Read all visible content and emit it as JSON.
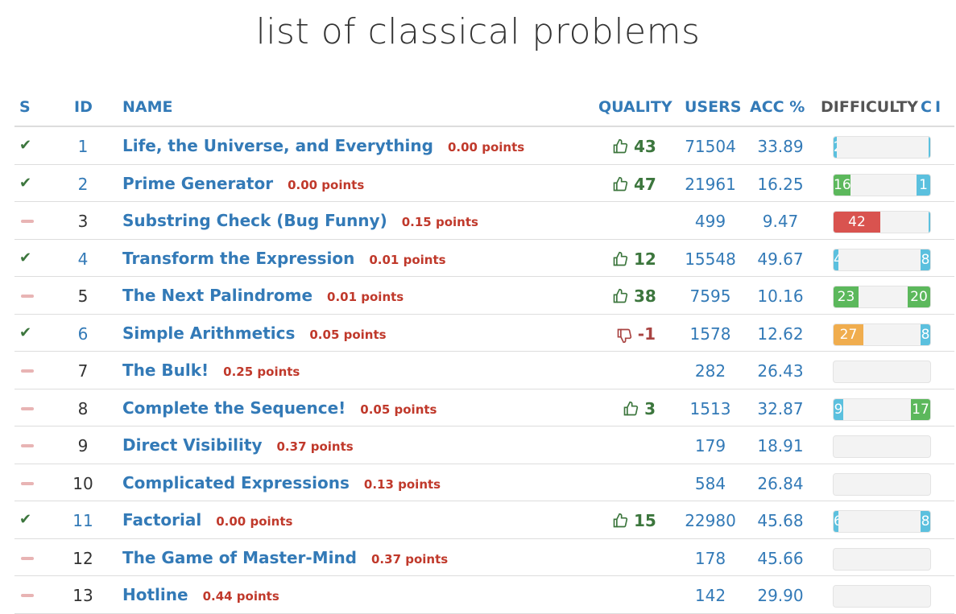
{
  "title": "list of classical problems",
  "columns": {
    "s": "S",
    "id": "ID",
    "name": "NAME",
    "quality": "QUALITY",
    "users": "USERS",
    "acc": "ACC %",
    "difficulty": "DIFFICULTY",
    "c": "C",
    "i": "I"
  },
  "colors": {
    "green": "#5cb85c",
    "blue": "#5bc0de",
    "red": "#d9534f",
    "orange": "#f0ad4e",
    "link": "#337ab7",
    "points": "#c0392b"
  },
  "rows": [
    {
      "status": "solved",
      "id": "1",
      "name": "Life, the Universe, and Everything",
      "points": "0.00 points",
      "quality": "43",
      "qtype": "up",
      "users": "71504",
      "acc": "33.89",
      "dl": {
        "text": "2",
        "color": "blue",
        "w": 3
      },
      "dr": {
        "text": "",
        "color": "blue",
        "w": 2
      }
    },
    {
      "status": "solved",
      "id": "2",
      "name": "Prime Generator",
      "points": "0.00 points",
      "quality": "47",
      "qtype": "up",
      "users": "21961",
      "acc": "16.25",
      "dl": {
        "text": "16",
        "color": "green",
        "w": 18
      },
      "dr": {
        "text": "1",
        "color": "blue",
        "w": 14
      }
    },
    {
      "status": "unsolved",
      "id": "3",
      "name": "Substring Check (Bug Funny)",
      "points": "0.15 points",
      "quality": "",
      "qtype": "none",
      "users": "499",
      "acc": "9.47",
      "dl": {
        "text": "42",
        "color": "red",
        "w": 49
      },
      "dr": {
        "text": "",
        "color": "blue",
        "w": 2
      }
    },
    {
      "status": "solved",
      "id": "4",
      "name": "Transform the Expression",
      "points": "0.01 points",
      "quality": "12",
      "qtype": "up",
      "users": "15548",
      "acc": "49.67",
      "dl": {
        "text": "4",
        "color": "blue",
        "w": 5
      },
      "dr": {
        "text": "8",
        "color": "blue",
        "w": 10
      }
    },
    {
      "status": "unsolved",
      "id": "5",
      "name": "The Next Palindrome",
      "points": "0.01 points",
      "quality": "38",
      "qtype": "up",
      "users": "7595",
      "acc": "10.16",
      "dl": {
        "text": "23",
        "color": "green",
        "w": 26
      },
      "dr": {
        "text": "20",
        "color": "green",
        "w": 24
      }
    },
    {
      "status": "solved",
      "id": "6",
      "name": "Simple Arithmetics",
      "points": "0.05 points",
      "quality": "-1",
      "qtype": "down",
      "users": "1578",
      "acc": "12.62",
      "dl": {
        "text": "27",
        "color": "orange",
        "w": 31
      },
      "dr": {
        "text": "8",
        "color": "blue",
        "w": 10
      }
    },
    {
      "status": "unsolved",
      "id": "7",
      "name": "The Bulk!",
      "points": "0.25 points",
      "quality": "",
      "qtype": "none",
      "users": "282",
      "acc": "26.43",
      "dl": null,
      "dr": null
    },
    {
      "status": "unsolved",
      "id": "8",
      "name": "Complete the Sequence!",
      "points": "0.05 points",
      "quality": "3",
      "qtype": "up",
      "users": "1513",
      "acc": "32.87",
      "dl": {
        "text": "9",
        "color": "blue",
        "w": 10
      },
      "dr": {
        "text": "17",
        "color": "green",
        "w": 20
      }
    },
    {
      "status": "unsolved",
      "id": "9",
      "name": "Direct Visibility",
      "points": "0.37 points",
      "quality": "",
      "qtype": "none",
      "users": "179",
      "acc": "18.91",
      "dl": null,
      "dr": null
    },
    {
      "status": "unsolved",
      "id": "10",
      "name": "Complicated Expressions",
      "points": "0.13 points",
      "quality": "",
      "qtype": "none",
      "users": "584",
      "acc": "26.84",
      "dl": null,
      "dr": null
    },
    {
      "status": "solved",
      "id": "11",
      "name": "Factorial",
      "points": "0.00 points",
      "quality": "15",
      "qtype": "up",
      "users": "22980",
      "acc": "45.68",
      "dl": {
        "text": "6",
        "color": "blue",
        "w": 5
      },
      "dr": {
        "text": "8",
        "color": "blue",
        "w": 10
      }
    },
    {
      "status": "unsolved",
      "id": "12",
      "name": "The Game of Master-Mind",
      "points": "0.37 points",
      "quality": "",
      "qtype": "none",
      "users": "178",
      "acc": "45.66",
      "dl": null,
      "dr": null
    },
    {
      "status": "unsolved",
      "id": "13",
      "name": "Hotline",
      "points": "0.44 points",
      "quality": "",
      "qtype": "none",
      "users": "142",
      "acc": "29.90",
      "dl": null,
      "dr": null
    }
  ]
}
